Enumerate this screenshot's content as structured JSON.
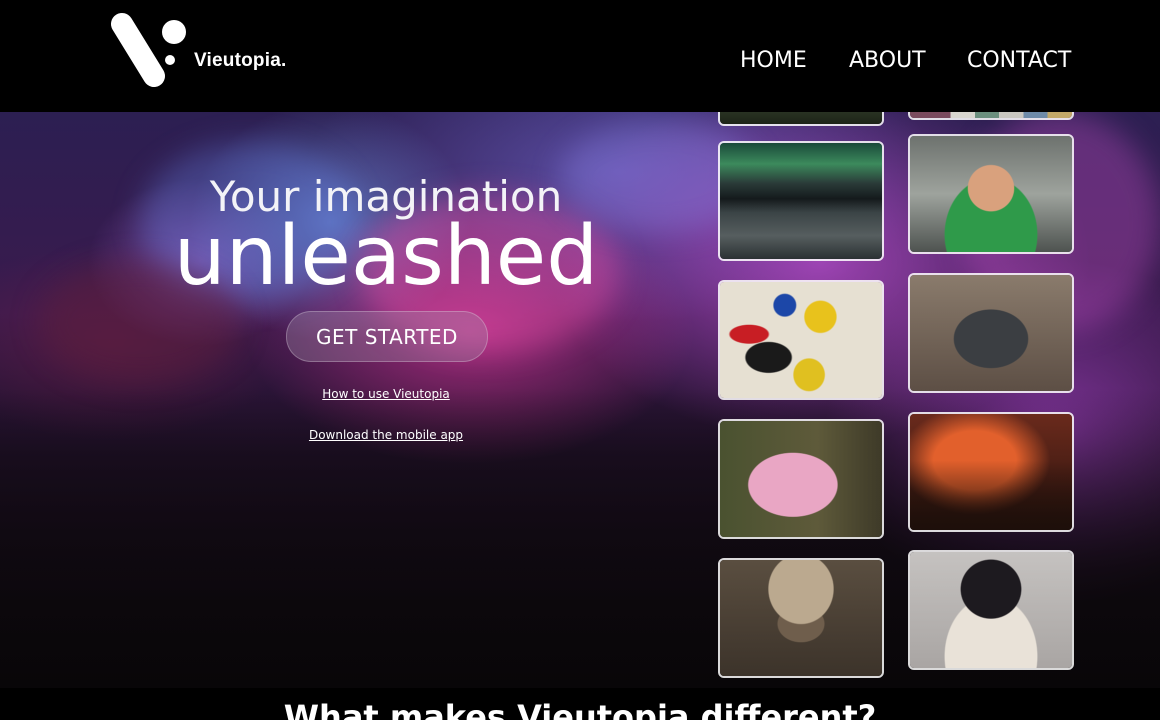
{
  "brand": {
    "name": "Vieutopia."
  },
  "nav": {
    "items": [
      "HOME",
      "ABOUT",
      "CONTACT"
    ]
  },
  "hero": {
    "subtitle": "Your imagination",
    "title": "unleashed",
    "cta_label": "GET STARTED",
    "links": [
      "How to use Vieutopia",
      "Download the mobile app"
    ]
  },
  "gallery": {
    "cards": [
      {
        "name": "gallery-card-forest-top",
        "subject": "forest"
      },
      {
        "name": "gallery-card-abstract-top",
        "subject": "abstract stripes"
      },
      {
        "name": "gallery-card-aurora-lake",
        "subject": "aurora over lake"
      },
      {
        "name": "gallery-card-green-hero",
        "subject": "green masked hero"
      },
      {
        "name": "gallery-card-abstract-art",
        "subject": "abstract art"
      },
      {
        "name": "gallery-card-robot",
        "subject": "robot"
      },
      {
        "name": "gallery-card-pink-squirrel",
        "subject": "pink squirrel"
      },
      {
        "name": "gallery-card-windmill-fire",
        "subject": "windmill in fire"
      },
      {
        "name": "gallery-card-man-hat",
        "subject": "man with hat"
      },
      {
        "name": "gallery-card-anime-girl",
        "subject": "anime girl"
      }
    ]
  },
  "section": {
    "title": "What makes Vieutopia different?"
  }
}
